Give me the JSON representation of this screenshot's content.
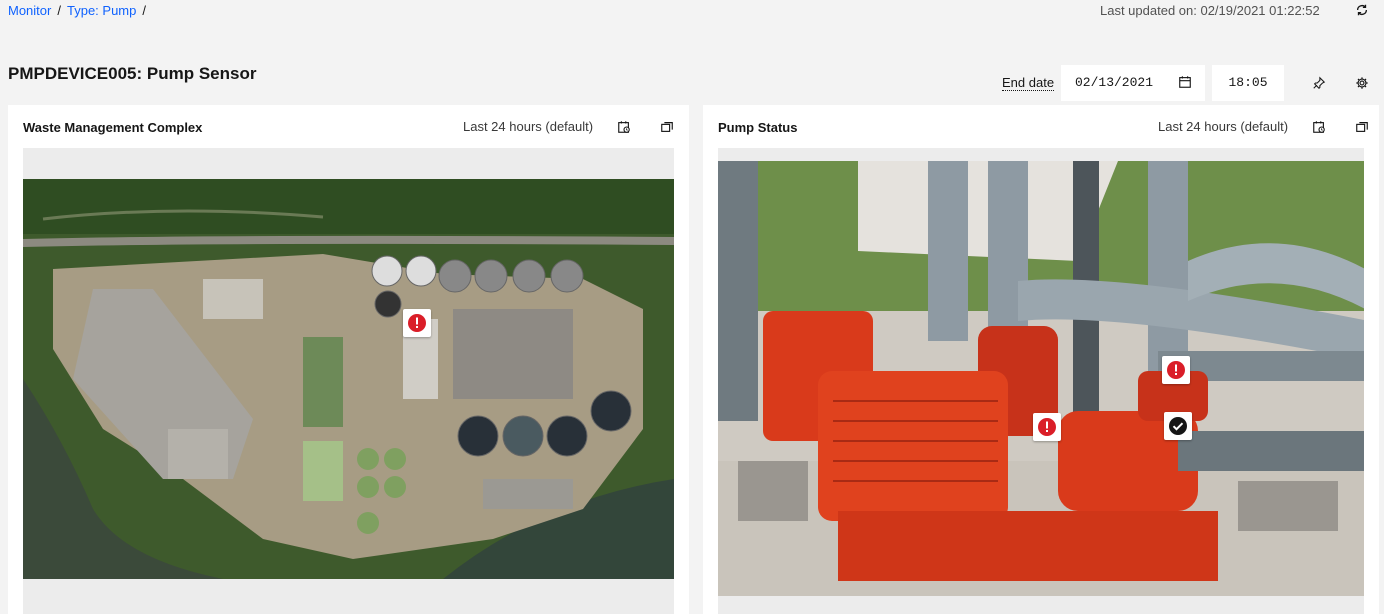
{
  "breadcrumb": {
    "root": "Monitor",
    "type": "Type: Pump",
    "sep": "/"
  },
  "header": {
    "last_updated": "Last updated on:  02/19/2021 01:22:52",
    "refresh_icon": "refresh-icon"
  },
  "page": {
    "title": "PMPDEVICE005: Pump Sensor"
  },
  "filters": {
    "end_date_label": "End date",
    "end_date_value": "02/13/2021",
    "time_value": "18:05",
    "calendar_icon": "calendar-icon",
    "pin_icon": "pin-icon",
    "settings_icon": "gear-icon"
  },
  "cards": [
    {
      "title": "Waste Management Complex",
      "range": "Last 24 hours (default)",
      "image": "aerial-plant-image",
      "markers": [
        {
          "status": "alert"
        }
      ]
    },
    {
      "title": "Pump Status",
      "range": "Last 24 hours (default)",
      "image": "pump-photo-image",
      "markers": [
        {
          "status": "alert"
        },
        {
          "status": "alert"
        },
        {
          "status": "ok"
        }
      ]
    }
  ],
  "colors": {
    "link": "#0f62fe",
    "alert": "#da1e28",
    "ok": "#161616",
    "pump": "#d93a1b",
    "pipe": "#8e9aa3"
  }
}
